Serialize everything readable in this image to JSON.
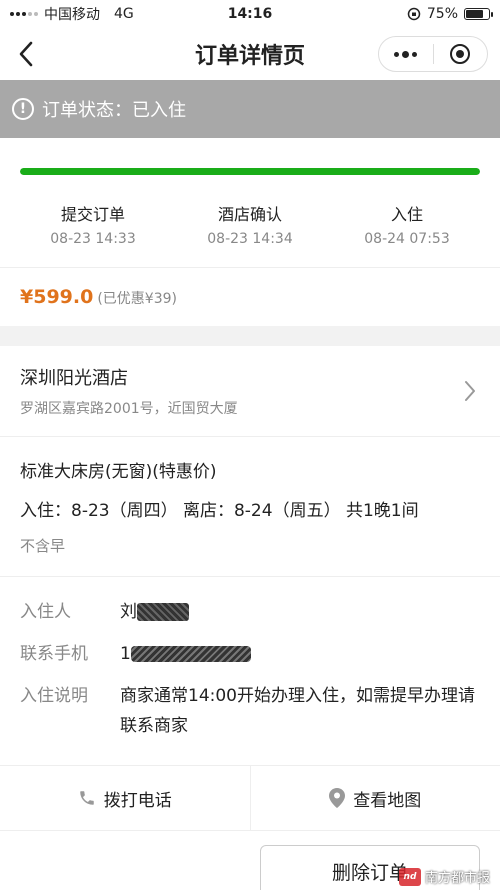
{
  "status_bar": {
    "carrier": "中国移动",
    "network": "4G",
    "time": "14:16",
    "battery_text": "75%",
    "battery_level": 0.75
  },
  "nav": {
    "title": "订单详情页"
  },
  "order_status": {
    "text": "订单状态：已入住"
  },
  "progress": {
    "fraction": 1.0,
    "color": "#1aad19",
    "steps": [
      {
        "label": "提交订单",
        "time": "08-23 14:33"
      },
      {
        "label": "酒店确认",
        "time": "08-23 14:34"
      },
      {
        "label": "入住",
        "time": "08-24 07:53"
      }
    ]
  },
  "price": {
    "amount": "¥599.0",
    "discount": "(已优惠¥39)",
    "color": "#e0731c"
  },
  "hotel": {
    "name": "深圳阳光酒店",
    "address": "罗湖区嘉宾路2001号，近国贸大厦"
  },
  "room": {
    "type": "标准大床房(无窗)(特惠价)",
    "dates": "入住：8-23（周四） 离店：8-24（周五） 共1晚1间",
    "breakfast": "不含早"
  },
  "guest": {
    "guest_label": "入住人",
    "guest_value": "刘",
    "phone_label": "联系手机",
    "phone_value": "1",
    "note_label": "入住说明",
    "note_value": "商家通常14:00开始办理入住，如需提早办理请联系商家"
  },
  "actions": {
    "call_label": "拨打电话",
    "map_label": "查看地图"
  },
  "delete_label": "删除订单",
  "watermark": {
    "logo": "nd",
    "text": "南方都市报"
  }
}
